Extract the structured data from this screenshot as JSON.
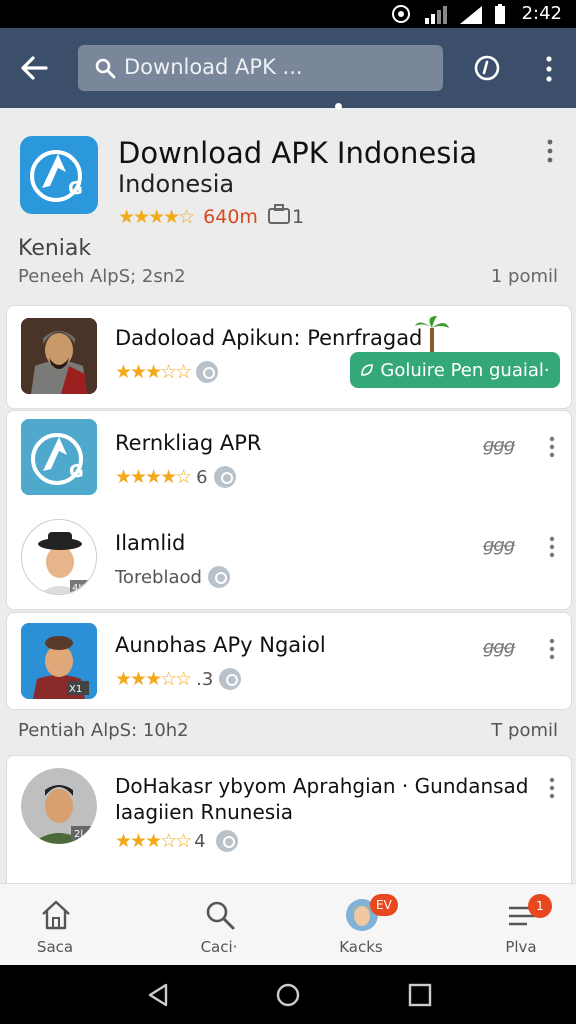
{
  "status_bar": {
    "time": "2:42"
  },
  "search": {
    "placeholder": "Download APK ..."
  },
  "hero": {
    "title": "Download APK Indonesia",
    "subtitle": "Indonesia",
    "stars": "★★★★☆",
    "downloads": "640m",
    "size": "1"
  },
  "section1": {
    "label": "Keniak",
    "subtitle": "Peneeh AlpS; 2sn2",
    "right": "1 pomil"
  },
  "apps": [
    {
      "name": "Dadoload Apikun: Penrfragad",
      "stars": "★★★☆☆",
      "meta_text": "",
      "action_label": "Goluire Pen guaial·"
    },
    {
      "name": "Rernkliag APR",
      "stars": "★★★★☆",
      "meta_text": "6",
      "eq": "ꞡꞡꞡ"
    },
    {
      "name": "Ilamlid",
      "stars": "",
      "meta_text": "Toreblaod",
      "eq": "ꞡꞡꞡ"
    },
    {
      "name": "Aunɒhas  APy Ngaiol",
      "stars": "★★★☆☆",
      "meta_text": ".3",
      "eq": "ꞡꞡꞡ"
    }
  ],
  "section2": {
    "label": "Pentiah AlpS: 10h2",
    "right": "T pomil"
  },
  "featured": {
    "line1": "DoHakasr ybyom Aprahgian · Gundansad",
    "line2": "Iaagiien Rnunesia",
    "stars": "★★★☆☆",
    "meta_text": "4"
  },
  "bottom_nav": [
    {
      "label": "Saca",
      "icon": "home-icon"
    },
    {
      "label": "Caci·",
      "icon": "search-icon"
    },
    {
      "label": "Kacks",
      "icon": "avatar-icon",
      "badge": "EV"
    },
    {
      "label": "Plva",
      "icon": "list-icon",
      "badge": "1"
    }
  ],
  "colors": {
    "appbar": "#3b4f6b",
    "accent_green": "#35a878",
    "star": "#f2a91c",
    "badge": "#e8471f"
  }
}
